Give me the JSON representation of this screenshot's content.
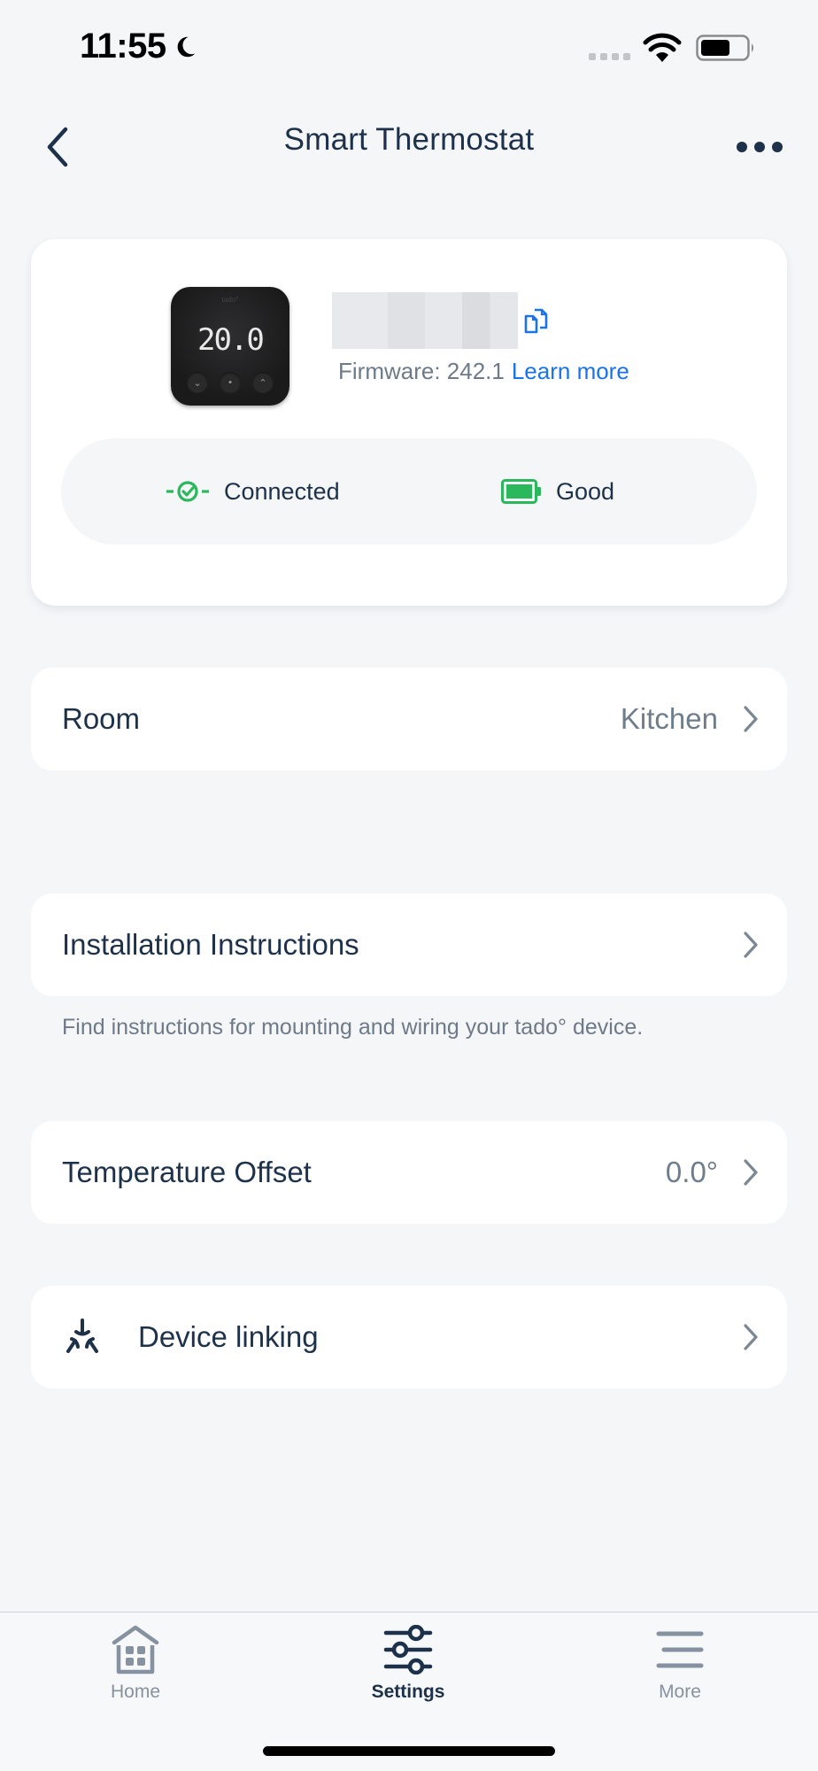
{
  "status_bar": {
    "time": "11:55",
    "focus_icon": "moon-icon",
    "signal_icon": "cellular-signal-icon",
    "wifi_icon": "wifi-icon",
    "battery_icon": "battery-icon",
    "battery_level": 0.6
  },
  "nav": {
    "title": "Smart Thermostat",
    "back_icon": "chevron-left-icon",
    "more_icon": "more-horizontal-icon"
  },
  "device": {
    "image_brand": "tado°",
    "image_display_temp": "20.0",
    "serial_number": "[redacted]",
    "copy_icon": "copy-icon",
    "firmware_label": "Firmware: 242.1",
    "learn_more_label": "Learn more",
    "colors": {
      "link": "#1a73e8",
      "status_ok": "#2bb85c"
    },
    "status": {
      "connection": {
        "icon": "connected-check-icon",
        "label": "Connected"
      },
      "battery": {
        "icon": "battery-full-icon",
        "label": "Good"
      }
    }
  },
  "settings": {
    "room": {
      "label": "Room",
      "value": "Kitchen"
    },
    "installation": {
      "label": "Installation Instructions",
      "helper": "Find instructions for mounting and wiring your tado° device."
    },
    "temperature_offset": {
      "label": "Temperature Offset",
      "value": "0.0°"
    },
    "device_linking": {
      "label": "Device linking",
      "icon": "device-linking-icon"
    }
  },
  "tab_bar": {
    "tabs": [
      {
        "label": "Home",
        "icon": "home-icon",
        "active": false
      },
      {
        "label": "Settings",
        "icon": "sliders-icon",
        "active": true
      },
      {
        "label": "More",
        "icon": "menu-icon",
        "active": false
      }
    ]
  }
}
